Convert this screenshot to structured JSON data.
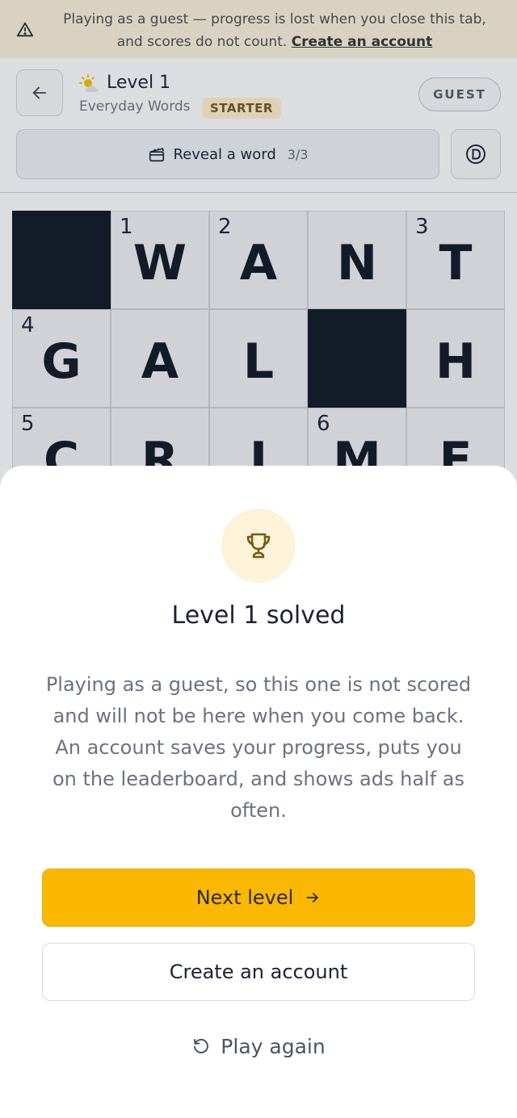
{
  "banner": {
    "message": "Playing as a guest — progress is lost when you close this tab, and scores do not count.",
    "link": "Create an account"
  },
  "header": {
    "level_title": "Level 1",
    "category": "Everyday Words",
    "tier": "STARTER",
    "guest_label": "GUEST"
  },
  "toolbar": {
    "reveal_label": "Reveal a word",
    "reveal_count": "3/3"
  },
  "grid": {
    "rows": [
      [
        {
          "black": true
        },
        {
          "num": "1",
          "letter": "W"
        },
        {
          "num": "2",
          "letter": "A"
        },
        {
          "letter": "N"
        },
        {
          "num": "3",
          "letter": "T"
        }
      ],
      [
        {
          "num": "4",
          "letter": "G"
        },
        {
          "letter": "A"
        },
        {
          "letter": "L"
        },
        {
          "black": true
        },
        {
          "letter": "H"
        }
      ],
      [
        {
          "num": "5",
          "letter": "C"
        },
        {
          "letter": "R"
        },
        {
          "letter": "I"
        },
        {
          "num": "6",
          "letter": "M"
        },
        {
          "letter": "E"
        }
      ]
    ]
  },
  "sheet": {
    "title": "Level 1 solved",
    "body": "Playing as a guest, so this one is not scored and will not be here when you come back. An account saves your progress, puts you on the leaderboard, and shows ads half as often.",
    "next_label": "Next level",
    "account_label": "Create an account",
    "replay_label": "Play again"
  },
  "colors": {
    "accent": "#fbb800",
    "banner_bg": "#f2e9d6",
    "black_cell": "#111827"
  },
  "icons": [
    "warning-icon",
    "back-arrow-icon",
    "sun-cloud-icon",
    "clapperboard-icon",
    "mode-d-icon",
    "trophy-icon",
    "arrow-right-icon",
    "replay-icon"
  ]
}
